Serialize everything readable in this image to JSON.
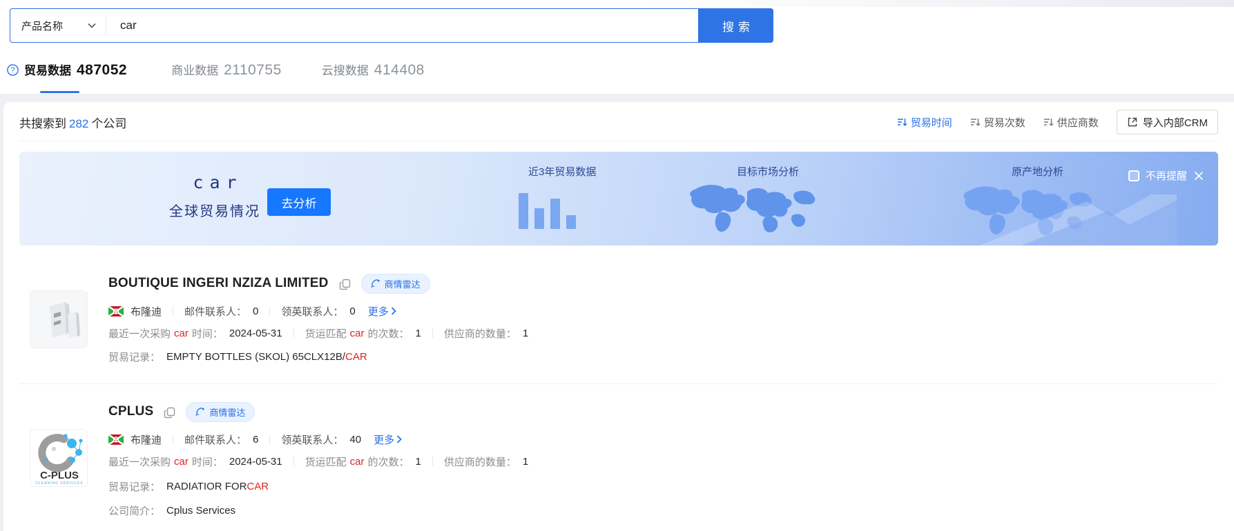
{
  "search_bar": {
    "category_label": "产品名称",
    "query": "car",
    "search_button": "搜索"
  },
  "tabs": [
    {
      "label": "贸易数据",
      "count": "487052",
      "active": true
    },
    {
      "label": "商业数据",
      "count": "2110755",
      "active": false
    },
    {
      "label": "云搜数据",
      "count": "414408",
      "active": false
    }
  ],
  "results_header": {
    "prefix": "共搜索到",
    "count": "282",
    "suffix": "个公司",
    "sorts": [
      {
        "label": "贸易时间",
        "active": true
      },
      {
        "label": "贸易次数",
        "active": false
      },
      {
        "label": "供应商数",
        "active": false
      }
    ],
    "crm_button": "导入内部CRM"
  },
  "banner": {
    "keyword": "car",
    "subtitle": "全球贸易情况",
    "analyze_button": "去分析",
    "panels": [
      "近3年贸易数据",
      "目标市场分析",
      "原产地分析"
    ],
    "dismiss_label": "不再提醒",
    "bars_rel_heights": [
      52,
      30,
      44,
      20
    ],
    "colors": {
      "primary": "#1677ff",
      "navy_text": "#2c4796",
      "bar": "#7ba6f0"
    }
  },
  "labels": {
    "radar_badge": "商情雷达",
    "email_contacts": "邮件联系人：",
    "linkedin_contacts": "领英联系人：",
    "more": "更多",
    "last_purchase_prefix": "最近一次采购",
    "time_label": "时间：",
    "freight_prefix": "货运匹配",
    "freight_suffix": "的次数：",
    "supplier_count_label": "供应商的数量：",
    "trade_record": "贸易记录：",
    "company_intro": "公司简介："
  },
  "icons": {
    "help": "?"
  },
  "companies": [
    {
      "name": "BOUTIQUE INGERI NZIZA LIMITED",
      "country": "布隆迪",
      "email_contacts": "0",
      "linkedin_contacts": "0",
      "keyword": "car",
      "last_purchase_date": "2024-05-31",
      "freight_count": "1",
      "supplier_count": "1",
      "trade_record_prefix": "EMPTY BOTTLES (SKOL) 65CLX12B/",
      "trade_record_keyword": "CAR"
    },
    {
      "name": "CPLUS",
      "country": "布隆迪",
      "email_contacts": "6",
      "linkedin_contacts": "40",
      "keyword": "car",
      "last_purchase_date": "2024-05-31",
      "freight_count": "1",
      "supplier_count": "1",
      "trade_record_prefix": "RADIATIOR FOR ",
      "trade_record_keyword": "CAR",
      "intro": "Cplus Services",
      "logo_text": "C-PLUS",
      "logo_tagline": "CLEANING SERVICES"
    }
  ]
}
